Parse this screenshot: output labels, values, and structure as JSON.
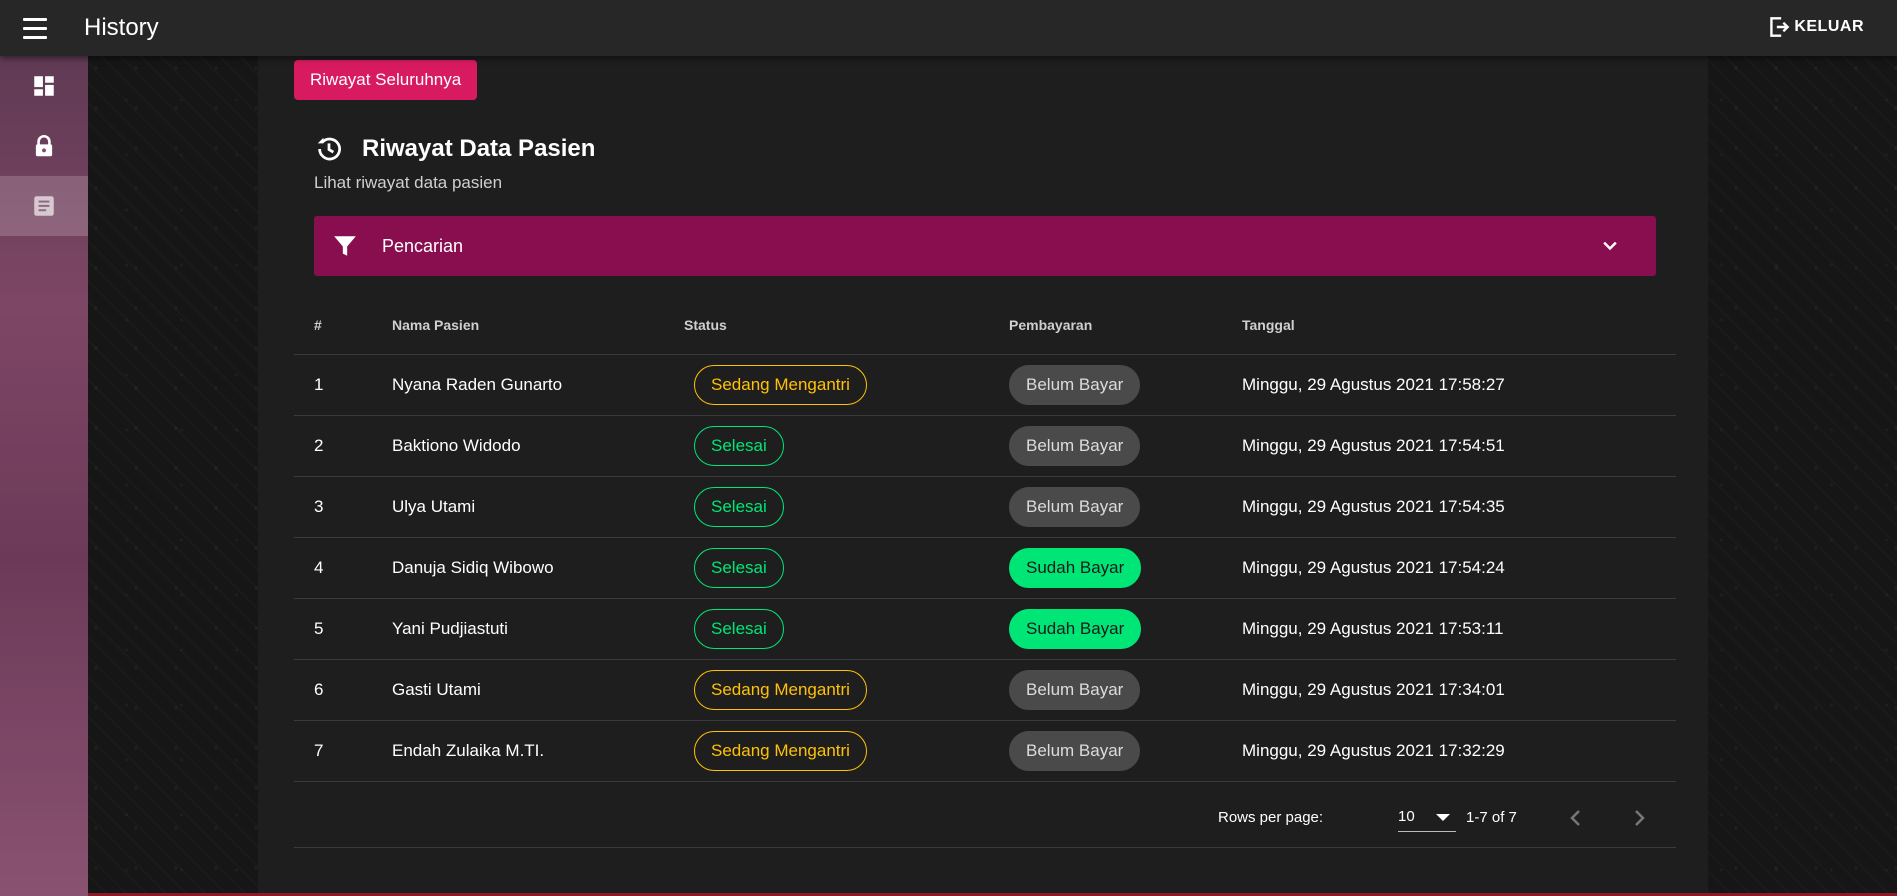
{
  "appbar": {
    "title": "History",
    "logout_label": "KELUAR"
  },
  "rail": {
    "items": [
      {
        "icon": "dashboard-icon"
      },
      {
        "icon": "lock-icon"
      },
      {
        "icon": "document-icon",
        "active": true
      }
    ]
  },
  "main": {
    "all_history_button": "Riwayat Seluruhnya",
    "title": "Riwayat Data Pasien",
    "subtitle": "Lihat riwayat data pasien",
    "search_panel_label": "Pencarian"
  },
  "table": {
    "headers": [
      "#",
      "Nama Pasien",
      "Status",
      "Pembayaran",
      "Tanggal"
    ],
    "rows": [
      {
        "no": "1",
        "name": "Nyana Raden Gunarto",
        "status": "Sedang Mengantri",
        "payment": "Belum Bayar",
        "date": "Minggu, 29 Agustus 2021 17:58:27"
      },
      {
        "no": "2",
        "name": "Baktiono Widodo",
        "status": "Selesai",
        "payment": "Belum Bayar",
        "date": "Minggu, 29 Agustus 2021 17:54:51"
      },
      {
        "no": "3",
        "name": "Ulya Utami",
        "status": "Selesai",
        "payment": "Belum Bayar",
        "date": "Minggu, 29 Agustus 2021 17:54:35"
      },
      {
        "no": "4",
        "name": "Danuja Sidiq Wibowo",
        "status": "Selesai",
        "payment": "Sudah Bayar",
        "date": "Minggu, 29 Agustus 2021 17:54:24"
      },
      {
        "no": "5",
        "name": "Yani Pudjiastuti",
        "status": "Selesai",
        "payment": "Sudah Bayar",
        "date": "Minggu, 29 Agustus 2021 17:53:11"
      },
      {
        "no": "6",
        "name": "Gasti Utami",
        "status": "Sedang Mengantri",
        "payment": "Belum Bayar",
        "date": "Minggu, 29 Agustus 2021 17:34:01"
      },
      {
        "no": "7",
        "name": "Endah Zulaika M.TI.",
        "status": "Sedang Mengantri",
        "payment": "Belum Bayar",
        "date": "Minggu, 29 Agustus 2021 17:32:29"
      }
    ]
  },
  "pagination": {
    "rows_per_page_label": "Rows per page:",
    "rows_per_page_value": "10",
    "page_info": "1-7 of 7"
  },
  "colors": {
    "accent_pink": "#d81b60",
    "search_panel": "#880e4f",
    "status_queue": "#ffc107",
    "status_done": "#00e676",
    "paid": "#00e676",
    "unpaid": "#4a4a4a"
  }
}
